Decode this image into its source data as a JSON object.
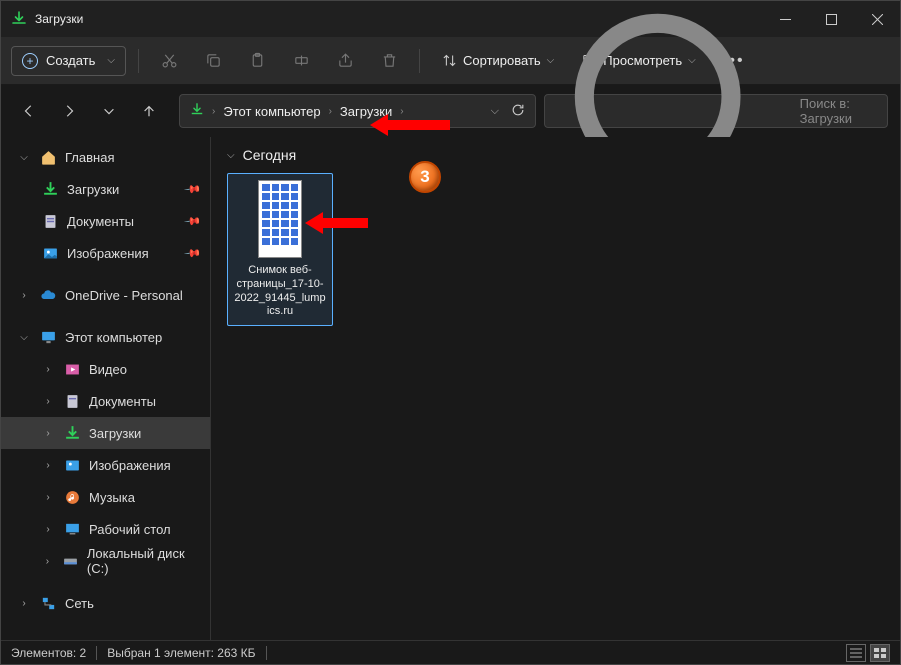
{
  "titlebar": {
    "title": "Загрузки"
  },
  "toolbar": {
    "new_label": "Создать",
    "sort_label": "Сортировать",
    "view_label": "Просмотреть"
  },
  "breadcrumb": {
    "seg1": "Этот компьютер",
    "seg2": "Загрузки"
  },
  "search": {
    "placeholder": "Поиск в: Загрузки"
  },
  "sidebar": {
    "home": "Главная",
    "downloads": "Загрузки",
    "documents": "Документы",
    "pictures": "Изображения",
    "onedrive": "OneDrive - Personal",
    "thispc": "Этот компьютер",
    "videos": "Видео",
    "documents2": "Документы",
    "downloads2": "Загрузки",
    "pictures2": "Изображения",
    "music": "Музыка",
    "desktop": "Рабочий стол",
    "localdisk": "Локальный диск (C:)",
    "network": "Сеть"
  },
  "content": {
    "group": "Сегодня",
    "file1": "Снимок веб-страницы_17-10-2022_91445_lumpics.ru"
  },
  "status": {
    "items": "Элементов: 2",
    "selected": "Выбран 1 элемент: 263 КБ"
  },
  "annotation": {
    "badge": "3"
  }
}
